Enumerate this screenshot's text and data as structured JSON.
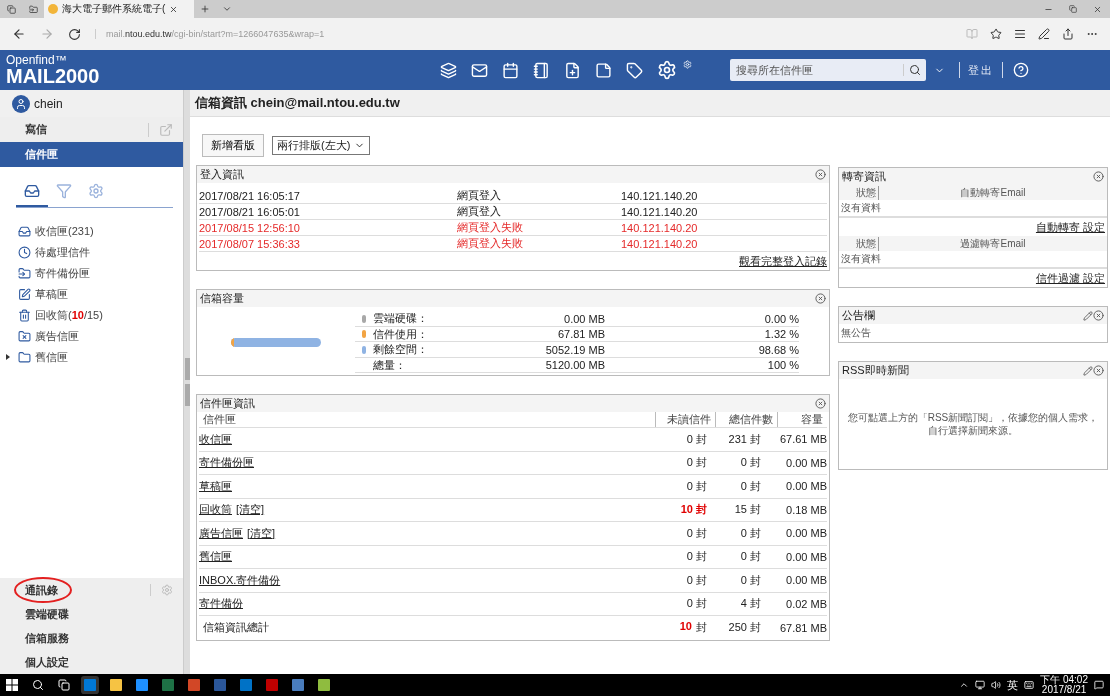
{
  "browser": {
    "tab_title": "海大電子郵件系統電子(",
    "url_start": "mail.",
    "url_domain": "ntou.edu.tw",
    "url_rest": "/cgi-bin/start?m=1266047635&wrap=1"
  },
  "header": {
    "logo_top": "Openfind™",
    "logo": "MAIL2000",
    "search_placeholder": "搜尋所在信件匣",
    "logout": "登出"
  },
  "user": "chein",
  "nav": [
    {
      "label": "寫信",
      "selected": false
    },
    {
      "label": "信件匣",
      "selected": true
    }
  ],
  "folder_tabs": [
    {
      "selected": true
    },
    {
      "selected": false
    },
    {
      "selected": false
    }
  ],
  "folders": [
    {
      "label": "收信匣(231)"
    },
    {
      "label": "待處理信件"
    },
    {
      "label": "寄件備份匣"
    },
    {
      "label": "草稿匣"
    },
    {
      "label": "回收筒(",
      "highlight": "10",
      "suffix": "/15)"
    },
    {
      "label": "廣告信匣"
    },
    {
      "label": "舊信匣",
      "expanded": false
    }
  ],
  "bottom_nav": [
    {
      "label": "通訊錄",
      "circled": true
    },
    {
      "label": "雲端硬碟",
      "circled": false
    },
    {
      "label": "信箱服務",
      "circled": false
    },
    {
      "label": "個人設定",
      "circled": false
    }
  ],
  "main": {
    "title": "信箱資訊 chein@mail.ntou.edu.tw",
    "add_board": "新增看版",
    "layout_select": "兩行排版(左大)"
  },
  "login": {
    "title": "登入資訊",
    "link": "觀看完整登入記錄",
    "rows": [
      {
        "time": "2017/08/21 16:05:17",
        "type": "網頁登入",
        "ip": "140.121.140.20",
        "failed": false
      },
      {
        "time": "2017/08/21 16:05:01",
        "type": "網頁登入",
        "ip": "140.121.140.20",
        "failed": false
      },
      {
        "time": "2017/08/15 12:56:10",
        "type": "網頁登入失敗",
        "ip": "140.121.140.20",
        "failed": true
      },
      {
        "time": "2017/08/07 15:36:33",
        "type": "網頁登入失敗",
        "ip": "140.121.140.20",
        "failed": true
      }
    ]
  },
  "capacity": {
    "title": "信箱容量",
    "meter": {
      "level": 0.0132
    },
    "rows": [
      {
        "label": "雲端硬碟：",
        "size": "0.00 MB",
        "percent": "0.00 %",
        "color": "#a8a8a8"
      },
      {
        "label": "信件使用：",
        "size": "67.81 MB",
        "percent": "1.32 %",
        "color": "#f2a444"
      },
      {
        "label": "剩餘空間：",
        "size": "5052.19 MB",
        "percent": "98.68 %",
        "color": "#8fb3e3"
      },
      {
        "label": "總量：",
        "size": "5120.00 MB",
        "percent": "100 %"
      }
    ]
  },
  "folder_info": {
    "title": "信件匣資訊",
    "columns": [
      "信件匣",
      "未讀信件",
      "總信件數",
      "容量"
    ],
    "rows": [
      {
        "name": "收信匣",
        "unread": "0 封",
        "total": "231 封",
        "size": "67.61 MB",
        "alert": false
      },
      {
        "name": "寄件備份匣",
        "unread": "0 封",
        "total": "0 封",
        "size": "0.00 MB",
        "alert": false
      },
      {
        "name": "草稿匣",
        "unread": "0 封",
        "total": "0 封",
        "size": "0.00 MB",
        "alert": false
      },
      {
        "name": "回收筒",
        "clear": "[清空]",
        "unread": "10 封",
        "total": "15 封",
        "size": "0.18 MB",
        "alert": true
      },
      {
        "name": "廣告信匣",
        "clear": "[清空]",
        "unread": "0 封",
        "total": "0 封",
        "size": "0.00 MB",
        "alert": false
      },
      {
        "name": "舊信匣",
        "unread": "0 封",
        "total": "0 封",
        "size": "0.00 MB",
        "alert": false
      },
      {
        "name": "INBOX.寄件備份",
        "unread": "0 封",
        "total": "0 封",
        "size": "0.00 MB",
        "alert": false
      },
      {
        "name": "寄件備份",
        "unread": "0 封",
        "total": "4 封",
        "size": "0.02 MB",
        "alert": false
      }
    ],
    "total": {
      "name": "信箱資訊總計",
      "unread_count": "10",
      "unread_unit": "封",
      "total": "250 封",
      "size": "67.81 MB"
    }
  },
  "forward": {
    "title": "轉寄資訊",
    "sections": [
      {
        "status": "狀態",
        "email": "自動轉寄Email",
        "empty": "沒有資料",
        "link": "自動轉寄 設定"
      },
      {
        "status": "狀態",
        "email": "過濾轉寄Email",
        "empty": "沒有資料",
        "link": "信件過濾 設定"
      }
    ]
  },
  "notice": {
    "title": "公告欄",
    "body": "無公告"
  },
  "rss": {
    "title": "RSS即時新聞",
    "body": "您可點選上方的「RSS新聞訂閱」，依據您的個人需求，自行選擇新聞來源。"
  },
  "taskbar": {
    "ime": "英",
    "time": "下午 04:02",
    "date": "2017/8/21"
  }
}
